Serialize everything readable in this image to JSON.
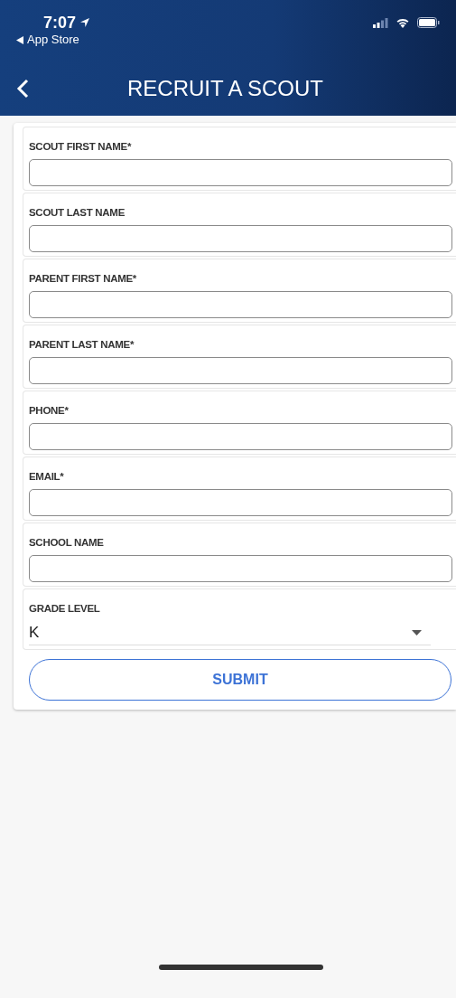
{
  "status_bar": {
    "time": "7:07",
    "back_app": "App Store"
  },
  "header": {
    "title": "RECRUIT A SCOUT"
  },
  "fields": [
    {
      "kind": "text",
      "label": "SCOUT FIRST NAME*"
    },
    {
      "kind": "text",
      "label": "SCOUT LAST NAME"
    },
    {
      "kind": "text",
      "label": "PARENT FIRST NAME*"
    },
    {
      "kind": "text",
      "label": "PARENT LAST NAME*"
    },
    {
      "kind": "text",
      "label": "PHONE*"
    },
    {
      "kind": "text",
      "label": "EMAIL*"
    },
    {
      "kind": "text",
      "label": "SCHOOL NAME"
    },
    {
      "kind": "select",
      "label": "GRADE LEVEL",
      "value": "K"
    }
  ],
  "submit": "SUBMIT"
}
